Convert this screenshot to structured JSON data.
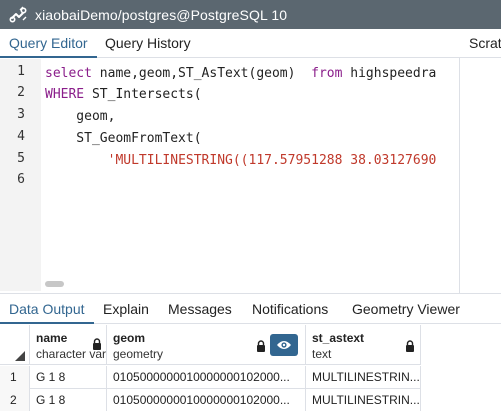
{
  "window": {
    "title": "xiaobaiDemo/postgres@PostgreSQL 10"
  },
  "top_tabs": [
    {
      "label": "Query Editor",
      "active": true
    },
    {
      "label": "Query History",
      "active": false
    },
    {
      "label": "Scrat",
      "active": false
    }
  ],
  "editor": {
    "line_numbers": [
      "1",
      "2",
      "3",
      "4",
      "5",
      "6"
    ],
    "lines": {
      "l1_kw1": "select",
      "l1_cols": " name,geom,ST_AsText(geom)  ",
      "l1_kw2": "from",
      "l1_rest": " highspeedra",
      "l2_kw": "WHERE",
      "l2_rest": " ST_Intersects(",
      "l3": "    geom,",
      "l4": "    ST_GeomFromText(",
      "l5_indent": "        ",
      "l5_str": "'MULTILINESTRING((117.57951288 38.03127690"
    }
  },
  "bottom_tabs": [
    {
      "label": "Data Output",
      "active": true
    },
    {
      "label": "Explain",
      "active": false
    },
    {
      "label": "Messages",
      "active": false
    },
    {
      "label": "Notifications",
      "active": false
    },
    {
      "label": "Geometry Viewer",
      "active": false
    }
  ],
  "grid": {
    "columns": [
      {
        "name": "name",
        "type": "character var"
      },
      {
        "name": "geom",
        "type": "geometry"
      },
      {
        "name": "st_astext",
        "type": "text"
      }
    ],
    "rows": [
      {
        "num": "1",
        "name": "G 1 8",
        "geom": "0105000000010000000102000...",
        "st_astext": "MULTILINESTRIN..."
      },
      {
        "num": "2",
        "name": "G 1 8",
        "geom": "0105000000010000000102000...",
        "st_astext": "MULTILINESTRIN..."
      }
    ]
  },
  "colors": {
    "titlebar": "#5b6770",
    "accent": "#326690",
    "keyword": "#8a1d8a",
    "string": "#c0392b"
  },
  "icons": {
    "app": "pgadmin-elephant-icon",
    "lock": "lock-icon",
    "viewer": "eye-icon"
  }
}
